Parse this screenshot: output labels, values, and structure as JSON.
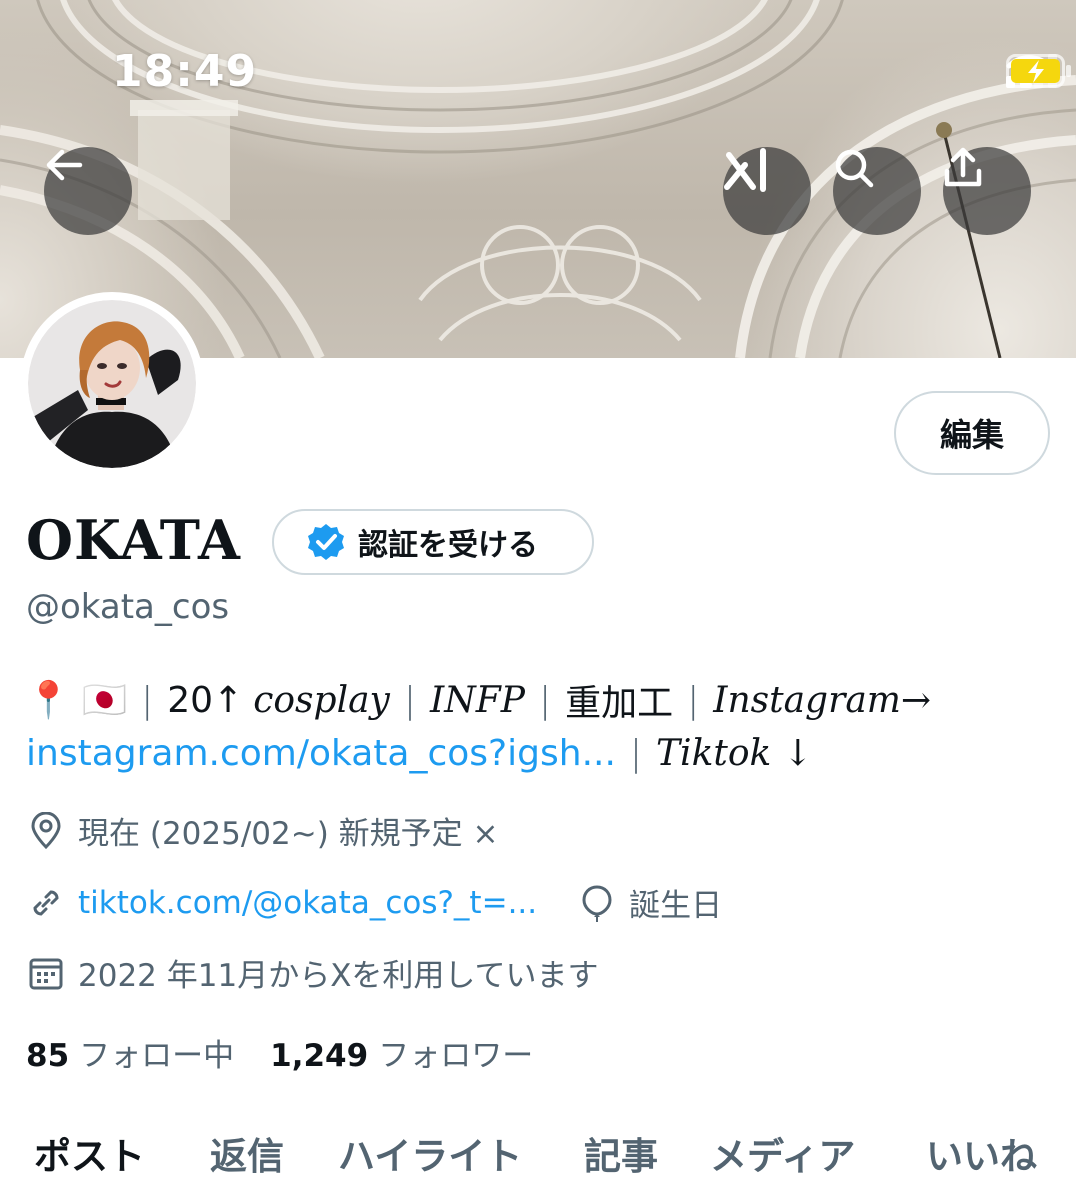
{
  "status_bar": {
    "time": "18:49"
  },
  "nav": {
    "back_icon": "arrow-left-icon",
    "grok_icon": "grok-icon",
    "search_icon": "search-icon",
    "share_icon": "share-icon"
  },
  "profile": {
    "edit_label": "編集",
    "name": "OKATA",
    "verify_label": "認証を受ける",
    "handle": "@okata_cos",
    "bio": {
      "line1_emoji": "📍 🇯🇵",
      "line1_age": "20↑",
      "line1_cosplay": "cosplay",
      "line1_type": "INFP",
      "line1_tag": "重加工",
      "line1_insta": "Instagram→",
      "line2_link": "instagram.com/okata_cos?igsh...",
      "line2_tiktok": "Tiktok ↓"
    },
    "location": "現在 (2025/02~) 新規予定 ×",
    "website": "tiktok.com/@okata_cos?_t=...",
    "birthday": "誕生日",
    "joined": "2022 年11月からXを利用しています",
    "following_count": "85",
    "following_label": "フォロー中",
    "followers_count": "1,249",
    "followers_label": "フォロワー"
  },
  "tabs": [
    {
      "label": "ポスト",
      "active": true
    },
    {
      "label": "返信",
      "active": false
    },
    {
      "label": "ハイライト",
      "active": false
    },
    {
      "label": "記事",
      "active": false
    },
    {
      "label": "メディア",
      "active": false
    },
    {
      "label": "いいね",
      "active": false
    }
  ],
  "colors": {
    "link": "#1d9bf0",
    "muted": "#536471",
    "text": "#0f1419",
    "verified": "#1d9bf0",
    "battery": "#f5d70e"
  }
}
